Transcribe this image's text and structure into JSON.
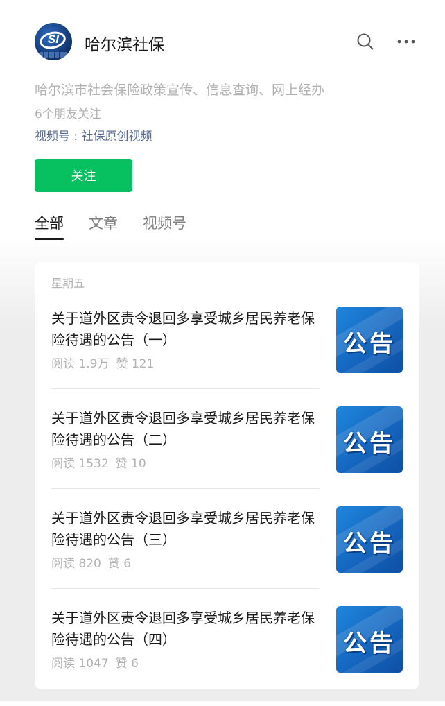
{
  "account": {
    "name": "哈尔滨社保",
    "avatar_text": "SI",
    "description": "哈尔滨市社会保险政策宣传、信息查询、网上经办",
    "friends_following": "6个朋友关注",
    "channel": "视频号 : 社保原创视频",
    "follow_label": "关注"
  },
  "icons": {
    "search": "search-icon",
    "more": "more-icon"
  },
  "tabs": [
    {
      "label": "全部",
      "active": true
    },
    {
      "label": "文章",
      "active": false
    },
    {
      "label": "视频号",
      "active": false
    }
  ],
  "feed": {
    "day_label": "星期五",
    "thumbnail_text": "公告",
    "articles": [
      {
        "title": "关于道外区责令退回多享受城乡居民养老保险待遇的公告（一）",
        "reads": "阅读 1.9万",
        "likes": "赞 121"
      },
      {
        "title": "关于道外区责令退回多享受城乡居民养老保险待遇的公告（二）",
        "reads": "阅读 1532",
        "likes": "赞 10"
      },
      {
        "title": "关于道外区责令退回多享受城乡居民养老保险待遇的公告（三）",
        "reads": "阅读 820",
        "likes": "赞 6"
      },
      {
        "title": "关于道外区责令退回多享受城乡居民养老保险待遇的公告（四）",
        "reads": "阅读 1047",
        "likes": "赞 6"
      }
    ]
  },
  "colors": {
    "follow_green": "#07c160",
    "link_blue": "#576b95",
    "thumbnail_blue": "#1566bf"
  }
}
